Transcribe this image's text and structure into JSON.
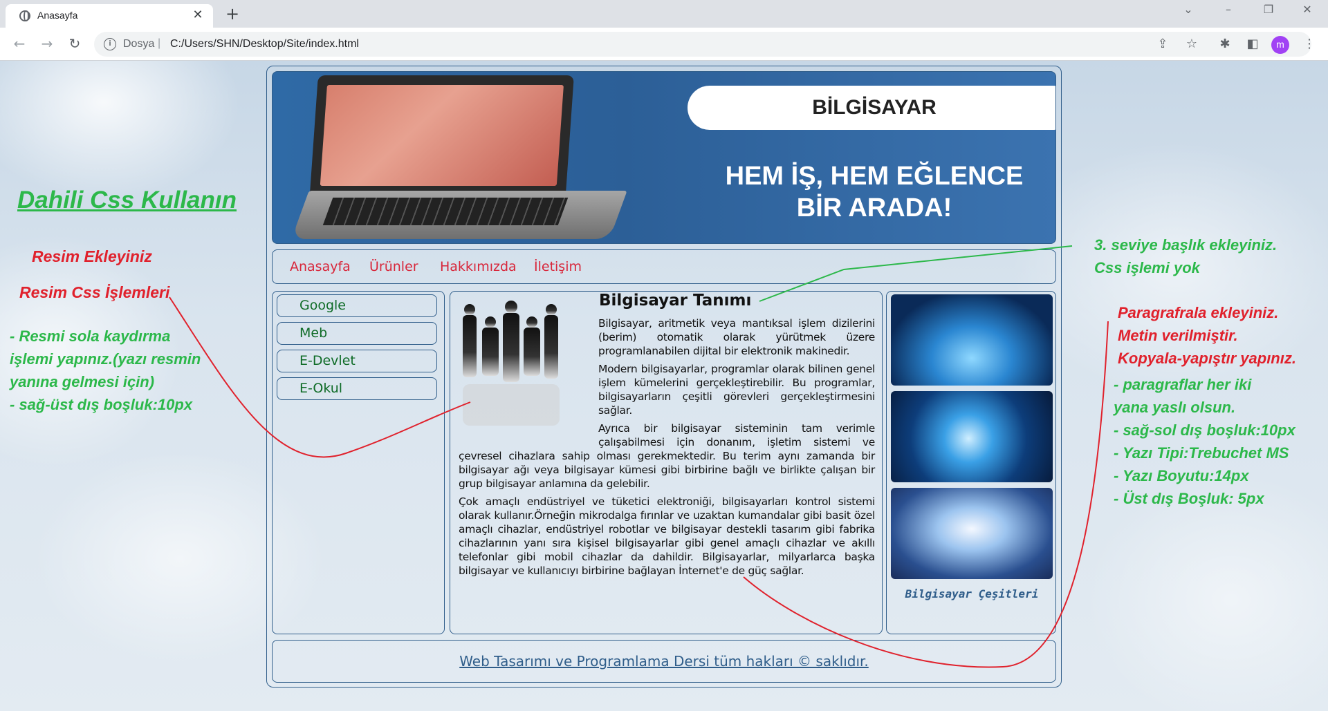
{
  "browser": {
    "tab_title": "Anasayfa",
    "new_tab_glyph": "+",
    "close_glyph": "✕",
    "scheme_label": "Dosya",
    "separator": "|",
    "url": "C:/Users/SHN/Desktop/Site/index.html",
    "avatar_letter": "m",
    "avatar_color": "#a142f4"
  },
  "site": {
    "banner": {
      "title": "BİLGİSAYAR",
      "slogan": "HEM İŞ, HEM EĞLENCE\nBİR ARADA!"
    },
    "menu": [
      "Anasayfa",
      "Ürünler",
      "Hakkımızda",
      "İletişim"
    ],
    "links": [
      "Google",
      "Meb",
      "E-Devlet",
      "E-Okul"
    ],
    "heading": "Bilgisayar Tanımı",
    "paragraphs": [
      "Bilgisayar, aritmetik veya mantıksal işlem dizilerini (berim) otomatik olarak yürütmek üzere programlanabilen dijital bir elektronik makinedir.",
      "Modern bilgisayarlar, programlar olarak bilinen genel işlem kümelerini gerçekleştirebilir. Bu programlar, bilgisayarların çeşitli görevleri gerçekleştirmesini sağlar.",
      "Ayrıca bir bilgisayar sisteminin tam verimle çalışabilmesi için donanım, işletim sistemi ve çevresel cihazlara sahip olması gerekmektedir. Bu terim aynı zamanda bir bilgisayar ağı veya bilgisayar kümesi gibi birbirine bağlı ve birlikte çalışan bir grup bilgisayar anlamına da gelebilir.",
      "Çok amaçlı endüstriyel ve tüketici elektroniği, bilgisayarları kontrol sistemi olarak kullanır.Örneğin mikrodalga fırınlar ve uzaktan kumandalar gibi basit özel amaçlı cihazlar, endüstriyel robotlar ve bilgisayar destekli tasarım gibi fabrika cihazlarının yanı sıra kişisel bilgisayarlar gibi genel amaçlı cihazlar ve akıllı telefonlar gibi mobil cihazlar da dahildir. Bilgisayarlar, milyarlarca başka bilgisayar ve kullanıcıyı birbirine bağlayan İnternet'e de güç sağlar."
    ],
    "sidebar_caption": "Bilgisayar Çeşitleri",
    "footer": "Web Tasarımı ve Programlama Dersi tüm hakları © saklıdır."
  },
  "annotations": {
    "css_title": "Dahili Css Kullanın",
    "add_image": "Resim Ekleyiniz",
    "image_css": "Resim Css İşlemleri",
    "image_rules": "- Resmi sola kaydırma\nişlemi yapınız.(yazı resmin\nyanına gelmesi için)\n- sağ-üst dış boşluk:10px",
    "heading_note": "3. seviye başlık ekleyiniz.\nCss işlemi yok",
    "paragraph_note": "Paragrafrala ekleyiniz.\nMetin verilmiştir.\nKopyala-yapıştır yapınız.",
    "paragraph_rules": "-  paragraflar her iki\nyana yaslı olsun.\n- sağ-sol dış boşluk:10px\n- Yazı Tipi:Trebuchet MS\n- Yazı Boyutu:14px\n- Üst dış Boşluk: 5px"
  },
  "colors": {
    "menu_link": "#d8263a",
    "side_link": "#0e6b26",
    "border": "#2f5d8a",
    "note_green": "#2cb84a",
    "note_red": "#e0212c"
  }
}
